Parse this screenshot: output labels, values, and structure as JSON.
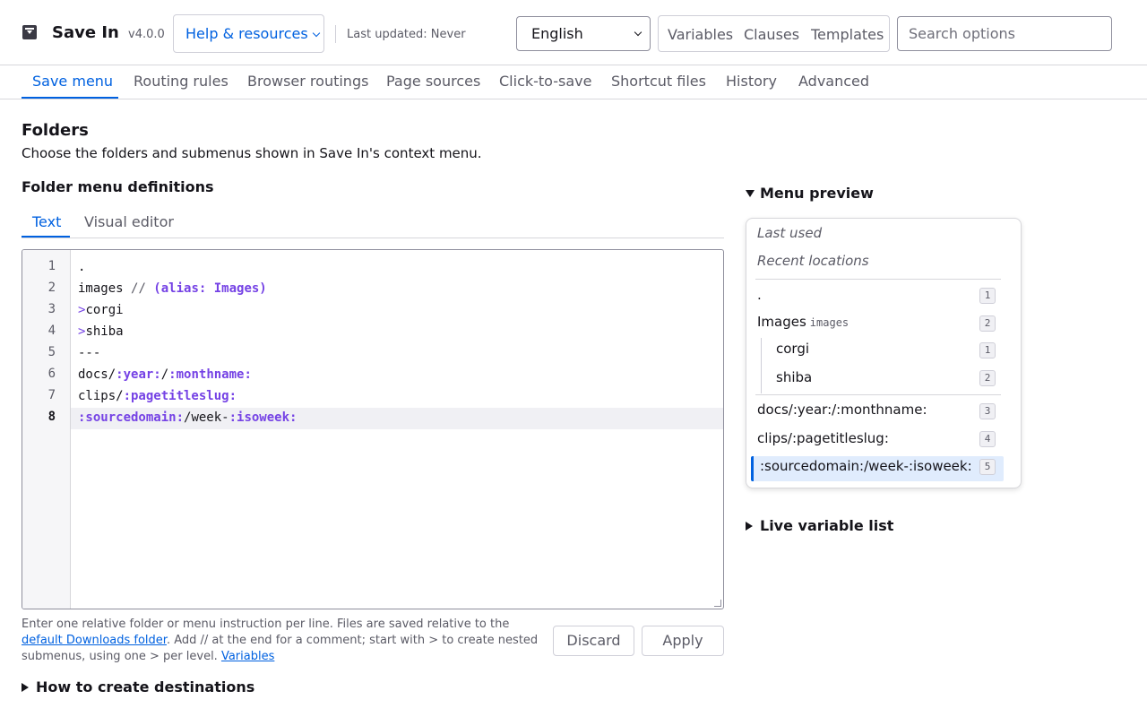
{
  "header": {
    "app_title": "Save In",
    "version": "v4.0.0",
    "help_label": "Help & resources",
    "last_updated": "Last updated: Never",
    "language": "English",
    "links": [
      "Variables",
      "Clauses",
      "Templates"
    ],
    "search_placeholder": "Search options"
  },
  "nav": {
    "tabs": [
      "Save menu",
      "Routing rules",
      "Browser routings",
      "Page sources",
      "Click-to-save",
      "Shortcut files",
      "History",
      "Advanced"
    ],
    "active": "Save menu"
  },
  "main": {
    "title": "Folders",
    "description": "Choose the folders and submenus shown in Save In's context menu.",
    "section_title": "Folder menu definitions",
    "editor_tabs": [
      "Text",
      "Visual editor"
    ],
    "editor_active_tab": "Text",
    "code_lines": [
      ".",
      "images // (alias: Images)",
      ">corgi",
      ">shiba",
      "---",
      "docs/:year:/:monthname:",
      "clips/:pagetitleslug:",
      ":sourcedomain:/week-:isoweek:"
    ],
    "current_line": 8,
    "help_text": {
      "part1": "Enter one relative folder or menu instruction per line. Files are saved relative to the",
      "link1": "default Downloads folder",
      "part2": ". Add // at the end for a comment; start with > to create nested submenus, using one > per level.",
      "link2": "Variables"
    },
    "discard_label": "Discard",
    "apply_label": "Apply",
    "how_to_label": "How to create destinations"
  },
  "preview": {
    "heading": "Menu preview",
    "last_used": "Last used",
    "recent": "Recent locations",
    "items": [
      {
        "label": ".",
        "sub": "",
        "badge": "1"
      },
      {
        "label": "Images",
        "sub": "images",
        "badge": "2"
      },
      {
        "label": "corgi",
        "sub": "",
        "badge": "1"
      },
      {
        "label": "shiba",
        "sub": "",
        "badge": "2"
      },
      {
        "label": "docs/:year:/:monthname:",
        "sub": "",
        "badge": "3"
      },
      {
        "label": "clips/:pagetitleslug:",
        "sub": "",
        "badge": "4"
      },
      {
        "label": ":sourcedomain:/week-:isoweek:",
        "sub": "",
        "badge": "5"
      }
    ],
    "live_variables_label": "Live variable list"
  },
  "colors": {
    "accent": "#0061e0",
    "token": "#7542e5",
    "text": "#15141a",
    "muted": "#5b5b66"
  }
}
